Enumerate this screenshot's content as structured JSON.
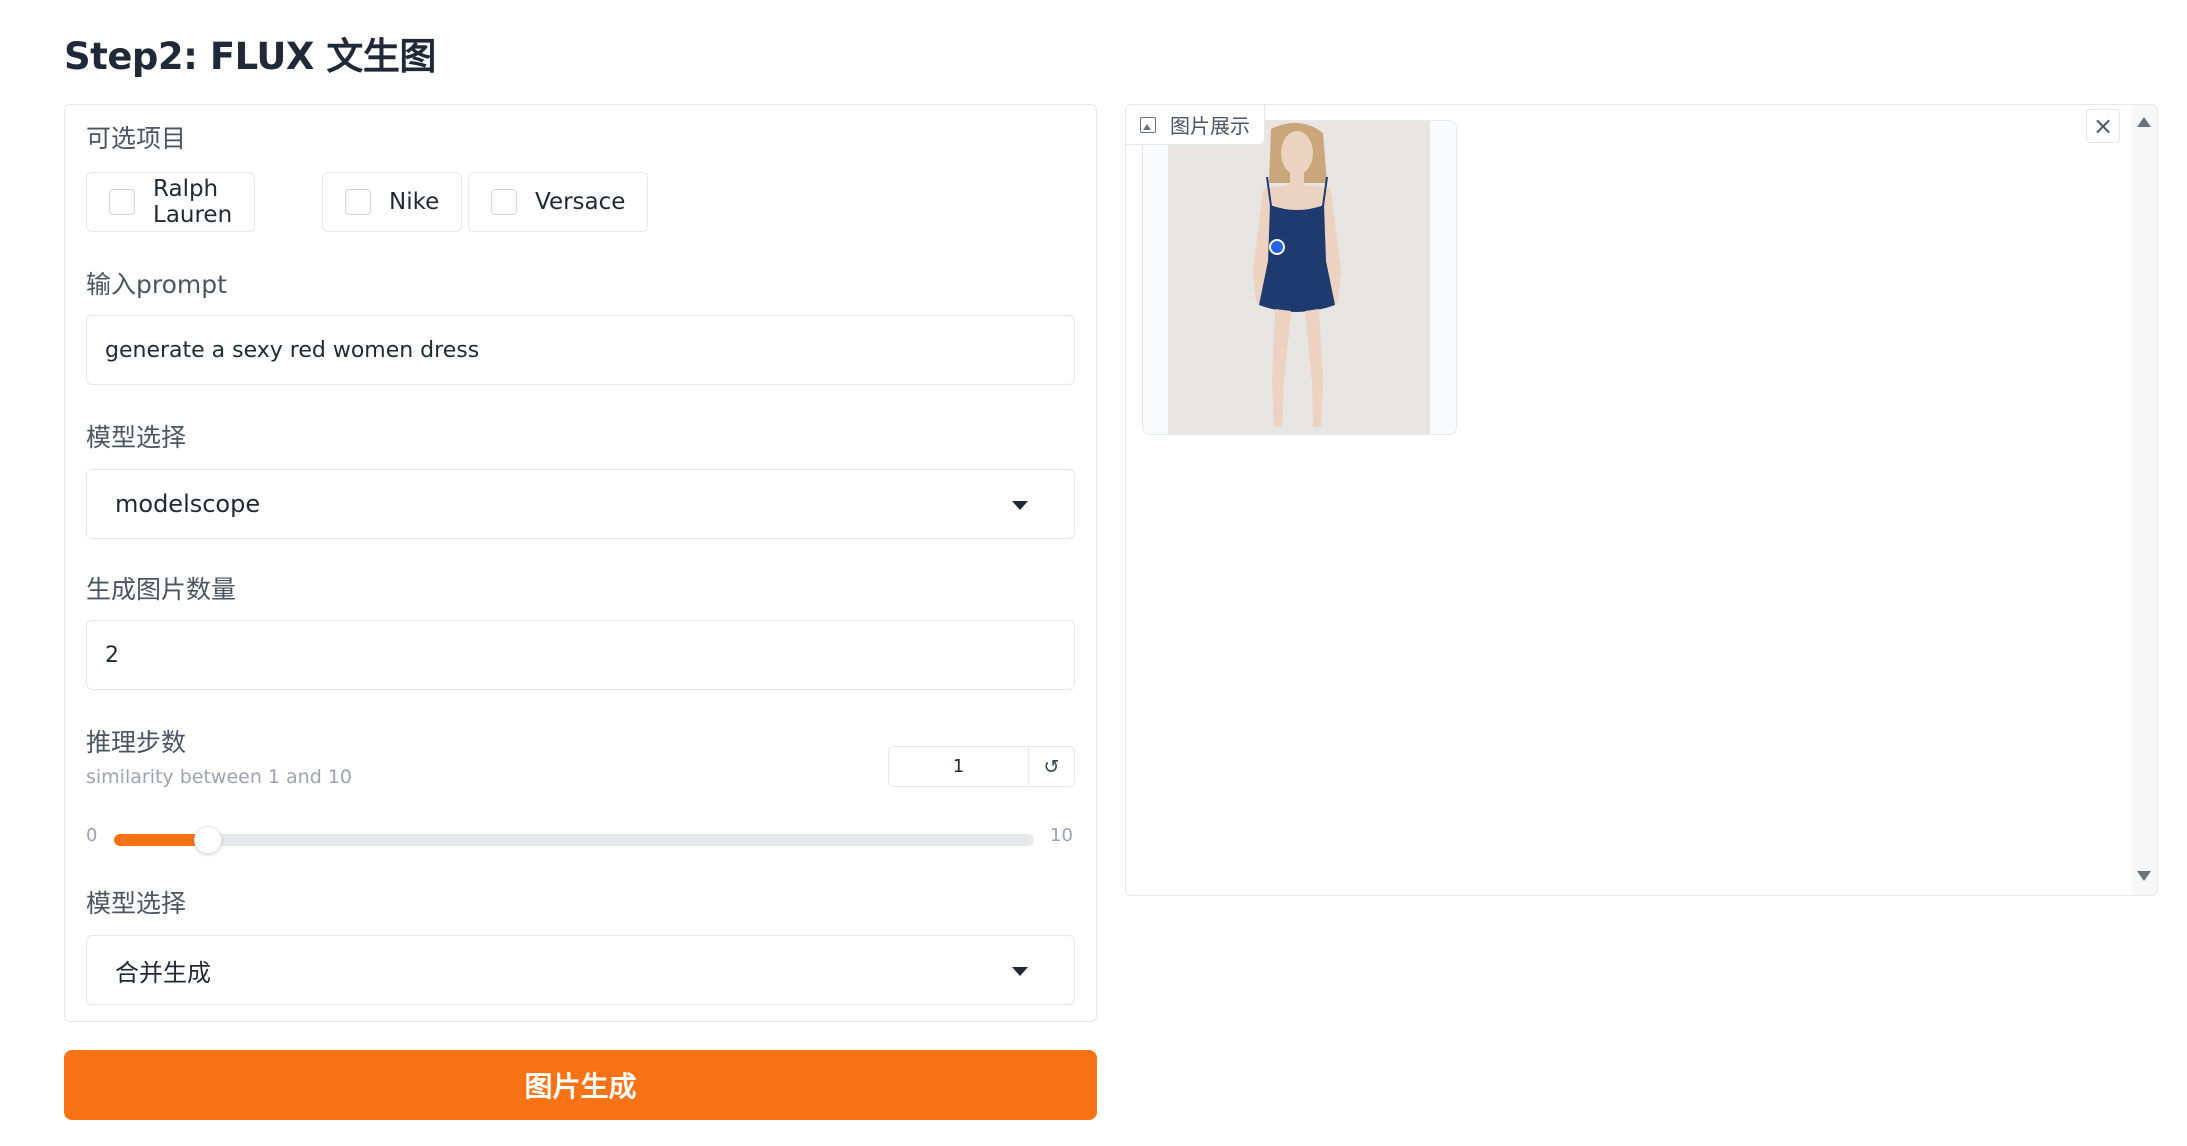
{
  "page": {
    "title": "Step2: FLUX 文生图"
  },
  "options": {
    "label": "可选项目",
    "items": [
      {
        "label": "Ralph Lauren",
        "checked": false
      },
      {
        "label": "Nike",
        "checked": false
      },
      {
        "label": "Versace",
        "checked": false
      }
    ]
  },
  "prompt": {
    "label": "输入prompt",
    "value": "generate a sexy red women dress"
  },
  "model_select": {
    "label": "模型选择",
    "value": "modelscope"
  },
  "image_count": {
    "label": "生成图片数量",
    "value": "2"
  },
  "steps": {
    "label": "推理步数",
    "info": "similarity between 1 and 10",
    "value": "1",
    "min": "0",
    "max": "10",
    "reset_icon": "↺",
    "fill_fraction": 0.1
  },
  "merge_select": {
    "label": "模型选择",
    "value": "合并生成"
  },
  "generate_button": {
    "label": "图片生成"
  },
  "gallery": {
    "label": "图片展示",
    "close_icon": "×"
  },
  "colors": {
    "accent": "#f97316",
    "dress": "#1e3a6e",
    "image_background": "#e8e4e2"
  }
}
